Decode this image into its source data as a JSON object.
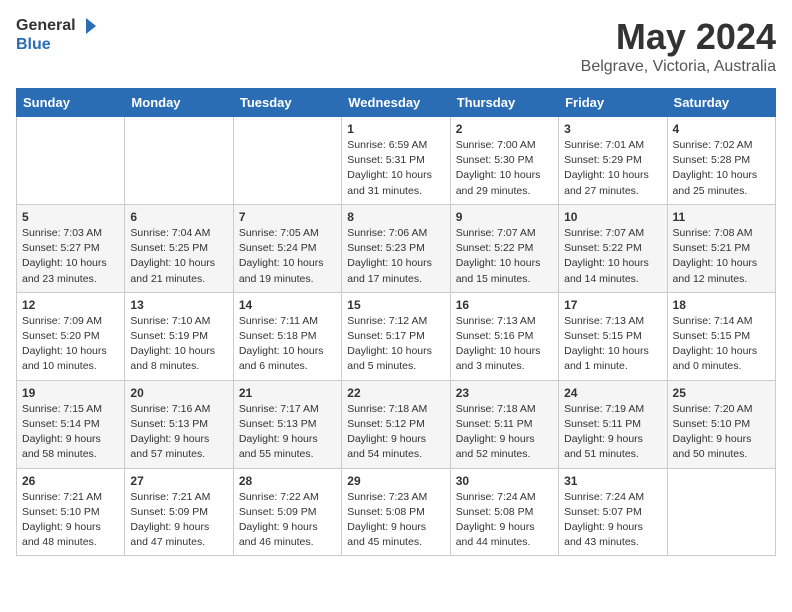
{
  "header": {
    "logo": {
      "general": "General",
      "blue": "Blue"
    },
    "title": "May 2024",
    "location": "Belgrave, Victoria, Australia"
  },
  "calendar": {
    "days_of_week": [
      "Sunday",
      "Monday",
      "Tuesday",
      "Wednesday",
      "Thursday",
      "Friday",
      "Saturday"
    ],
    "weeks": [
      [
        {
          "day": "",
          "info": ""
        },
        {
          "day": "",
          "info": ""
        },
        {
          "day": "",
          "info": ""
        },
        {
          "day": "1",
          "info": "Sunrise: 6:59 AM\nSunset: 5:31 PM\nDaylight: 10 hours\nand 31 minutes."
        },
        {
          "day": "2",
          "info": "Sunrise: 7:00 AM\nSunset: 5:30 PM\nDaylight: 10 hours\nand 29 minutes."
        },
        {
          "day": "3",
          "info": "Sunrise: 7:01 AM\nSunset: 5:29 PM\nDaylight: 10 hours\nand 27 minutes."
        },
        {
          "day": "4",
          "info": "Sunrise: 7:02 AM\nSunset: 5:28 PM\nDaylight: 10 hours\nand 25 minutes."
        }
      ],
      [
        {
          "day": "5",
          "info": "Sunrise: 7:03 AM\nSunset: 5:27 PM\nDaylight: 10 hours\nand 23 minutes."
        },
        {
          "day": "6",
          "info": "Sunrise: 7:04 AM\nSunset: 5:25 PM\nDaylight: 10 hours\nand 21 minutes."
        },
        {
          "day": "7",
          "info": "Sunrise: 7:05 AM\nSunset: 5:24 PM\nDaylight: 10 hours\nand 19 minutes."
        },
        {
          "day": "8",
          "info": "Sunrise: 7:06 AM\nSunset: 5:23 PM\nDaylight: 10 hours\nand 17 minutes."
        },
        {
          "day": "9",
          "info": "Sunrise: 7:07 AM\nSunset: 5:22 PM\nDaylight: 10 hours\nand 15 minutes."
        },
        {
          "day": "10",
          "info": "Sunrise: 7:07 AM\nSunset: 5:22 PM\nDaylight: 10 hours\nand 14 minutes."
        },
        {
          "day": "11",
          "info": "Sunrise: 7:08 AM\nSunset: 5:21 PM\nDaylight: 10 hours\nand 12 minutes."
        }
      ],
      [
        {
          "day": "12",
          "info": "Sunrise: 7:09 AM\nSunset: 5:20 PM\nDaylight: 10 hours\nand 10 minutes."
        },
        {
          "day": "13",
          "info": "Sunrise: 7:10 AM\nSunset: 5:19 PM\nDaylight: 10 hours\nand 8 minutes."
        },
        {
          "day": "14",
          "info": "Sunrise: 7:11 AM\nSunset: 5:18 PM\nDaylight: 10 hours\nand 6 minutes."
        },
        {
          "day": "15",
          "info": "Sunrise: 7:12 AM\nSunset: 5:17 PM\nDaylight: 10 hours\nand 5 minutes."
        },
        {
          "day": "16",
          "info": "Sunrise: 7:13 AM\nSunset: 5:16 PM\nDaylight: 10 hours\nand 3 minutes."
        },
        {
          "day": "17",
          "info": "Sunrise: 7:13 AM\nSunset: 5:15 PM\nDaylight: 10 hours\nand 1 minute."
        },
        {
          "day": "18",
          "info": "Sunrise: 7:14 AM\nSunset: 5:15 PM\nDaylight: 10 hours\nand 0 minutes."
        }
      ],
      [
        {
          "day": "19",
          "info": "Sunrise: 7:15 AM\nSunset: 5:14 PM\nDaylight: 9 hours\nand 58 minutes."
        },
        {
          "day": "20",
          "info": "Sunrise: 7:16 AM\nSunset: 5:13 PM\nDaylight: 9 hours\nand 57 minutes."
        },
        {
          "day": "21",
          "info": "Sunrise: 7:17 AM\nSunset: 5:13 PM\nDaylight: 9 hours\nand 55 minutes."
        },
        {
          "day": "22",
          "info": "Sunrise: 7:18 AM\nSunset: 5:12 PM\nDaylight: 9 hours\nand 54 minutes."
        },
        {
          "day": "23",
          "info": "Sunrise: 7:18 AM\nSunset: 5:11 PM\nDaylight: 9 hours\nand 52 minutes."
        },
        {
          "day": "24",
          "info": "Sunrise: 7:19 AM\nSunset: 5:11 PM\nDaylight: 9 hours\nand 51 minutes."
        },
        {
          "day": "25",
          "info": "Sunrise: 7:20 AM\nSunset: 5:10 PM\nDaylight: 9 hours\nand 50 minutes."
        }
      ],
      [
        {
          "day": "26",
          "info": "Sunrise: 7:21 AM\nSunset: 5:10 PM\nDaylight: 9 hours\nand 48 minutes."
        },
        {
          "day": "27",
          "info": "Sunrise: 7:21 AM\nSunset: 5:09 PM\nDaylight: 9 hours\nand 47 minutes."
        },
        {
          "day": "28",
          "info": "Sunrise: 7:22 AM\nSunset: 5:09 PM\nDaylight: 9 hours\nand 46 minutes."
        },
        {
          "day": "29",
          "info": "Sunrise: 7:23 AM\nSunset: 5:08 PM\nDaylight: 9 hours\nand 45 minutes."
        },
        {
          "day": "30",
          "info": "Sunrise: 7:24 AM\nSunset: 5:08 PM\nDaylight: 9 hours\nand 44 minutes."
        },
        {
          "day": "31",
          "info": "Sunrise: 7:24 AM\nSunset: 5:07 PM\nDaylight: 9 hours\nand 43 minutes."
        },
        {
          "day": "",
          "info": ""
        }
      ]
    ]
  }
}
